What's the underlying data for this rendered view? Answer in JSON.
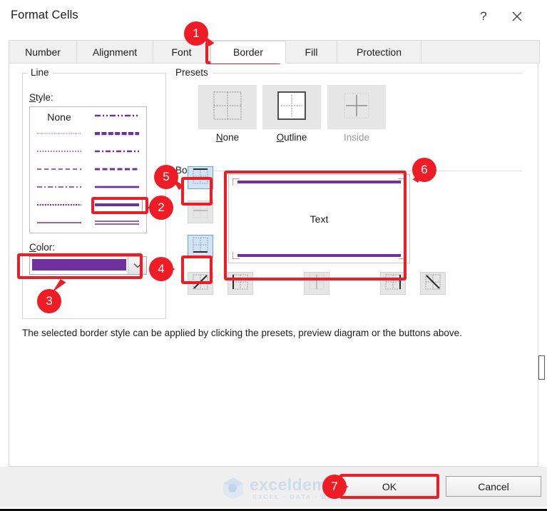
{
  "window": {
    "title": "Format Cells",
    "help_icon": "question-mark-icon",
    "close_icon": "close-x-icon"
  },
  "tabs": [
    {
      "label": "Number",
      "active": false
    },
    {
      "label": "Alignment",
      "active": false
    },
    {
      "label": "Font",
      "active": false
    },
    {
      "label": "Border",
      "active": true
    },
    {
      "label": "Fill",
      "active": false
    },
    {
      "label": "Protection",
      "active": false
    }
  ],
  "line_group": {
    "caption": "Line",
    "style_label": "Style:",
    "style_none_label": "None",
    "styles": [
      {
        "row": 0,
        "col": 0,
        "kind": "none",
        "selected": false
      },
      {
        "row": 1,
        "col": 0,
        "kind": "hairline-dot",
        "selected": false
      },
      {
        "row": 2,
        "col": 0,
        "kind": "dotted",
        "selected": false
      },
      {
        "row": 3,
        "col": 0,
        "kind": "dashed",
        "selected": false
      },
      {
        "row": 4,
        "col": 0,
        "kind": "dash-dot",
        "selected": false
      },
      {
        "row": 5,
        "col": 0,
        "kind": "dense-dot",
        "selected": false
      },
      {
        "row": 6,
        "col": 0,
        "kind": "thin-solid",
        "selected": false
      },
      {
        "row": 0,
        "col": 1,
        "kind": "dash-dot-dot",
        "selected": false
      },
      {
        "row": 1,
        "col": 1,
        "kind": "slant-dash",
        "selected": false
      },
      {
        "row": 2,
        "col": 1,
        "kind": "medium-dash-dot",
        "selected": false
      },
      {
        "row": 3,
        "col": 1,
        "kind": "thick-dash",
        "selected": false
      },
      {
        "row": 4,
        "col": 1,
        "kind": "medium-solid",
        "selected": false
      },
      {
        "row": 5,
        "col": 1,
        "kind": "thick-solid",
        "selected": true
      },
      {
        "row": 6,
        "col": 1,
        "kind": "double",
        "selected": false
      }
    ],
    "color_label": "Color:",
    "color_value": "#7030a0",
    "color_dropdown_icon": "chevron-down-icon"
  },
  "presets": {
    "caption": "Presets",
    "items": [
      {
        "label": "None",
        "icon": "preset-none-icon",
        "disabled": false
      },
      {
        "label": "Outline",
        "icon": "preset-outline-icon",
        "disabled": false
      },
      {
        "label": "Inside",
        "icon": "preset-inside-icon",
        "disabled": true
      }
    ]
  },
  "border_section": {
    "caption": "Border",
    "preview_text": "Text",
    "border_color": "#7030a0",
    "left_buttons": [
      {
        "name": "top-border-button",
        "icon": "border-top-icon",
        "active": true,
        "disabled": false
      },
      {
        "name": "inside-horizontal-border-button",
        "icon": "border-inside-h-icon",
        "active": false,
        "disabled": true
      },
      {
        "name": "bottom-border-button",
        "icon": "border-bottom-icon",
        "active": true,
        "disabled": false
      }
    ],
    "bottom_buttons": [
      {
        "name": "diagonal-up-border-button",
        "icon": "border-diagonal-up-icon",
        "active": false,
        "disabled": false
      },
      {
        "name": "left-border-button",
        "icon": "border-left-icon",
        "active": false,
        "disabled": false
      },
      {
        "name": "inside-vertical-border-button",
        "icon": "border-inside-v-icon",
        "active": false,
        "disabled": true
      },
      {
        "name": "right-border-button",
        "icon": "border-right-icon",
        "active": false,
        "disabled": false
      },
      {
        "name": "diagonal-down-border-button",
        "icon": "border-diagonal-down-icon",
        "active": false,
        "disabled": false
      }
    ],
    "applied": {
      "top": true,
      "bottom": true,
      "left": false,
      "right": false
    }
  },
  "help_text": "The selected border style can be applied by clicking the presets, preview diagram or the buttons above.",
  "footer": {
    "ok_label": "OK",
    "cancel_label": "Cancel"
  },
  "watermark": {
    "word": "exceldemy",
    "tagline": "EXCEL  ·  DATA  ·  BI"
  },
  "annotations": {
    "accent_color": "#ee1c25",
    "badges": [
      {
        "n": "1",
        "target": "border-tab"
      },
      {
        "n": "2",
        "target": "thick-solid-style-swatch"
      },
      {
        "n": "3",
        "target": "color-dropdown"
      },
      {
        "n": "4",
        "target": "bottom-border-button"
      },
      {
        "n": "5",
        "target": "top-border-button"
      },
      {
        "n": "6",
        "target": "border-preview-diagram"
      },
      {
        "n": "7",
        "target": "ok-button"
      }
    ]
  }
}
